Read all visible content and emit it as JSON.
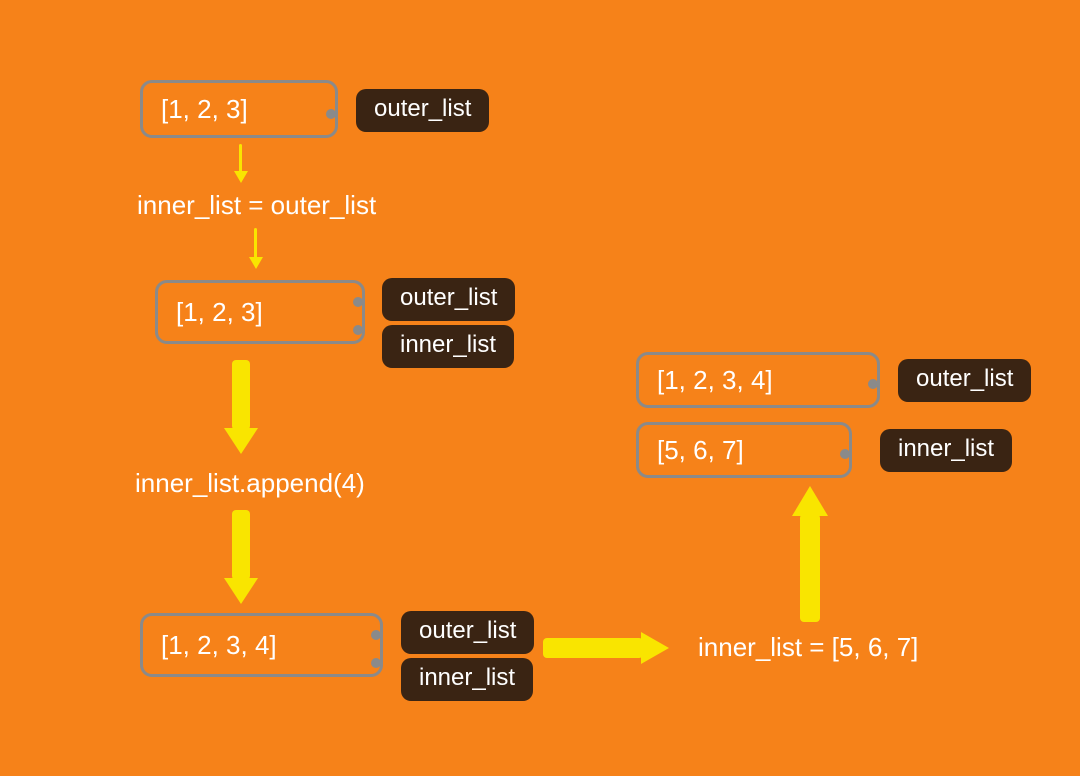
{
  "boxes": {
    "step1": "[1, 2, 3]",
    "step3": "[1, 2, 3]",
    "step5": "[1, 2, 3, 4]",
    "final_outer": "[1, 2, 3, 4]",
    "final_inner": "[5, 6, 7]"
  },
  "tags": {
    "outer": "outer_list",
    "inner": "inner_list"
  },
  "code": {
    "assign1": "inner_list = outer_list",
    "append": "inner_list.append(4)",
    "assign2": "inner_list = [5, 6, 7]"
  }
}
